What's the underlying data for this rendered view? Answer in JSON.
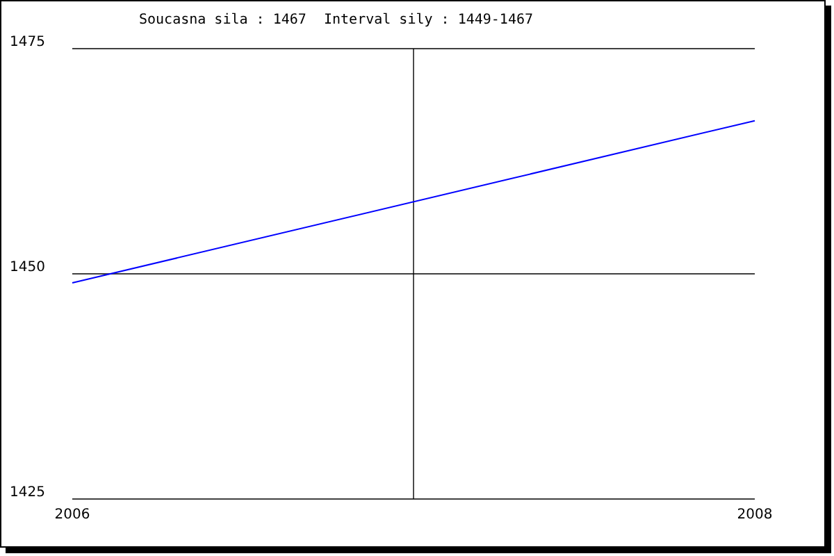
{
  "header": {
    "current_label": "Soucasna sila : 1467",
    "interval_label": "Interval sily : 1449-1467"
  },
  "chart": {
    "chart_data": {
      "type": "line",
      "x": [
        2006,
        2008
      ],
      "series": [
        {
          "color": "#0000ff",
          "values": [
            1449,
            1467
          ]
        }
      ],
      "xlim": [
        2006,
        2008
      ],
      "ylim": [
        1425,
        1475
      ],
      "xticks": [
        2006,
        2008
      ],
      "yticks": [
        1425,
        1450,
        1475
      ]
    }
  }
}
